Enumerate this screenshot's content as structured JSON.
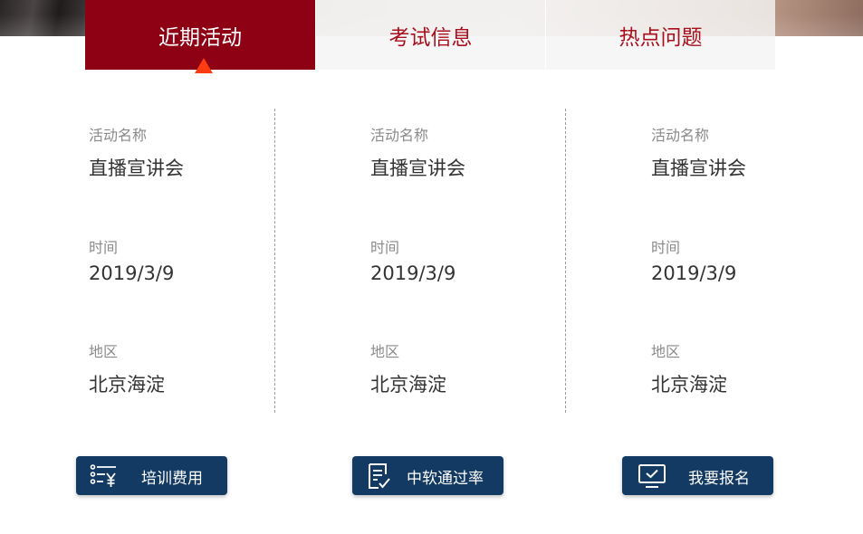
{
  "tabs": [
    {
      "label": "近期活动",
      "active": true
    },
    {
      "label": "考试信息",
      "active": false
    },
    {
      "label": "热点问题",
      "active": false
    }
  ],
  "columns": [
    {
      "name_label": "活动名称",
      "name_value": "直播宣讲会",
      "time_label": "时间",
      "time_value": "2019/3/9",
      "area_label": "地区",
      "area_value": "北京海淀"
    },
    {
      "name_label": "活动名称",
      "name_value": "直播宣讲会",
      "time_label": "时间",
      "time_value": "2019/3/9",
      "area_label": "地区",
      "area_value": "北京海淀"
    },
    {
      "name_label": "活动名称",
      "name_value": "直播宣讲会",
      "time_label": "时间",
      "time_value": "2019/3/9",
      "area_label": "地区",
      "area_value": "北京海淀"
    }
  ],
  "buttons": [
    {
      "label": "培训费用",
      "icon": "fee-list-icon"
    },
    {
      "label": "中软通过率",
      "icon": "document-check-icon"
    },
    {
      "label": "我要报名",
      "icon": "monitor-check-icon"
    }
  ],
  "colors": {
    "active_tab": "#8e0013",
    "tab_text": "#a8101e",
    "pointer": "#ff3b12",
    "button": "#133a62"
  }
}
